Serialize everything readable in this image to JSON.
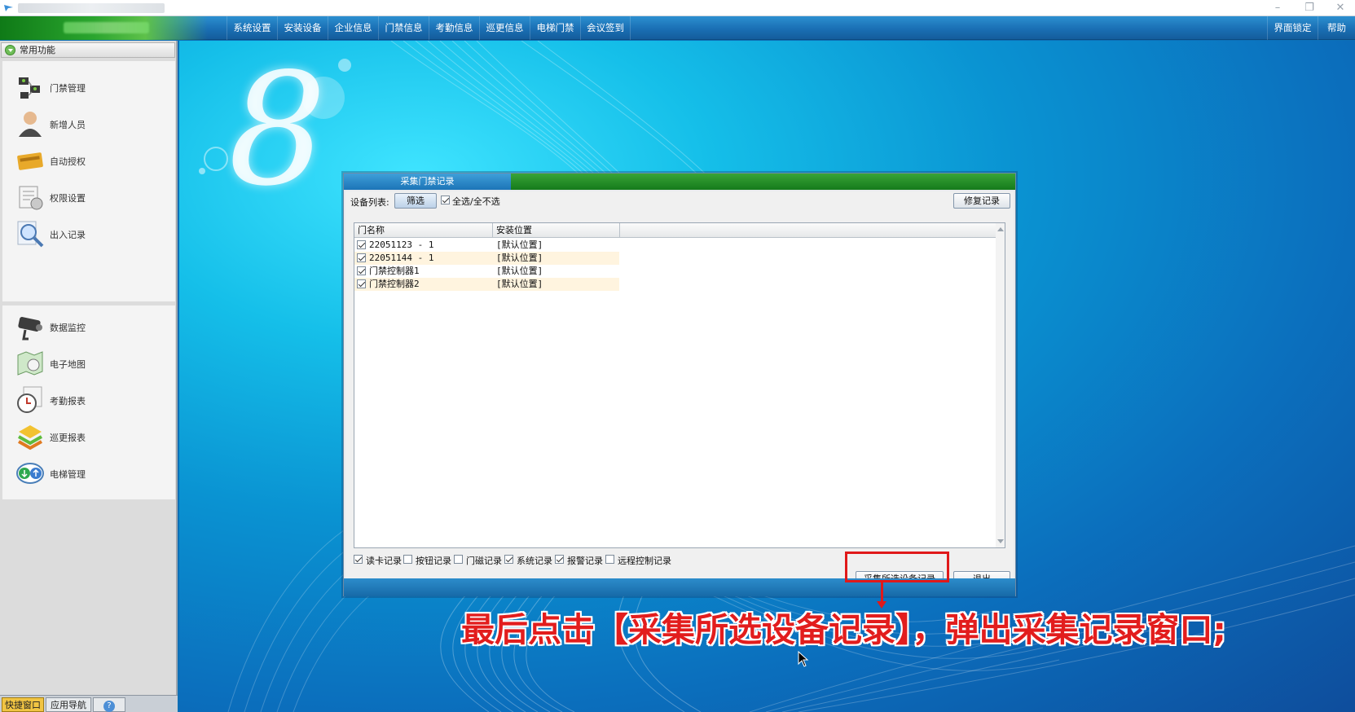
{
  "window": {
    "controls": [
      "–",
      "❐",
      "✕"
    ]
  },
  "menubar": {
    "items": [
      "系统设置",
      "安装设备",
      "企业信息",
      "门禁信息",
      "考勤信息",
      "巡更信息",
      "电梯门禁",
      "会议签到"
    ],
    "right_items": [
      "界面锁定",
      "帮助"
    ]
  },
  "sidebar": {
    "header": "常用功能",
    "group1": [
      {
        "label": "门禁管理",
        "icon": "door-access-icon"
      },
      {
        "label": "新增人员",
        "icon": "person-icon"
      },
      {
        "label": "自动授权",
        "icon": "card-icon"
      },
      {
        "label": "权限设置",
        "icon": "permission-icon"
      },
      {
        "label": "出入记录",
        "icon": "magnifier-icon"
      }
    ],
    "group2": [
      {
        "label": "数据监控",
        "icon": "camera-icon"
      },
      {
        "label": "电子地图",
        "icon": "map-icon"
      },
      {
        "label": "考勤报表",
        "icon": "clock-icon"
      },
      {
        "label": "巡更报表",
        "icon": "patrol-icon"
      },
      {
        "label": "电梯管理",
        "icon": "elevator-icon"
      }
    ],
    "bottom_tabs": [
      "快捷窗口",
      "应用导航",
      "?"
    ]
  },
  "desktop": {
    "logo_digit": "8"
  },
  "dialog": {
    "tab": "采集门禁记录",
    "device_list_label": "设备列表:",
    "filter_button": "筛选",
    "select_all_label": "全选/全不选",
    "select_all_checked": true,
    "repair_button": "修复记录",
    "columns": [
      "门名称",
      "安装位置"
    ],
    "rows": [
      {
        "name": "22051123 - 1",
        "location": "[默认位置]",
        "checked": true
      },
      {
        "name": "22051144 - 1",
        "location": "[默认位置]",
        "checked": true
      },
      {
        "name": "门禁控制器1",
        "location": "[默认位置]",
        "checked": true
      },
      {
        "name": "门禁控制器2",
        "location": "[默认位置]",
        "checked": true
      }
    ],
    "record_types": [
      {
        "label": "读卡记录",
        "checked": true
      },
      {
        "label": "按钮记录",
        "checked": false
      },
      {
        "label": "门磁记录",
        "checked": false
      },
      {
        "label": "系统记录",
        "checked": true
      },
      {
        "label": "报警记录",
        "checked": true
      },
      {
        "label": "远程控制记录",
        "checked": false
      }
    ],
    "collect_button": "采集所选设备记录",
    "exit_button": "退出"
  },
  "caption": "最后点击【采集所选设备记录】，弹出采集记录窗口;",
  "colors": {
    "accent_green": "#2aa52e",
    "menubar_blue": "#1a6fb4",
    "highlight_red": "#e0191a"
  }
}
